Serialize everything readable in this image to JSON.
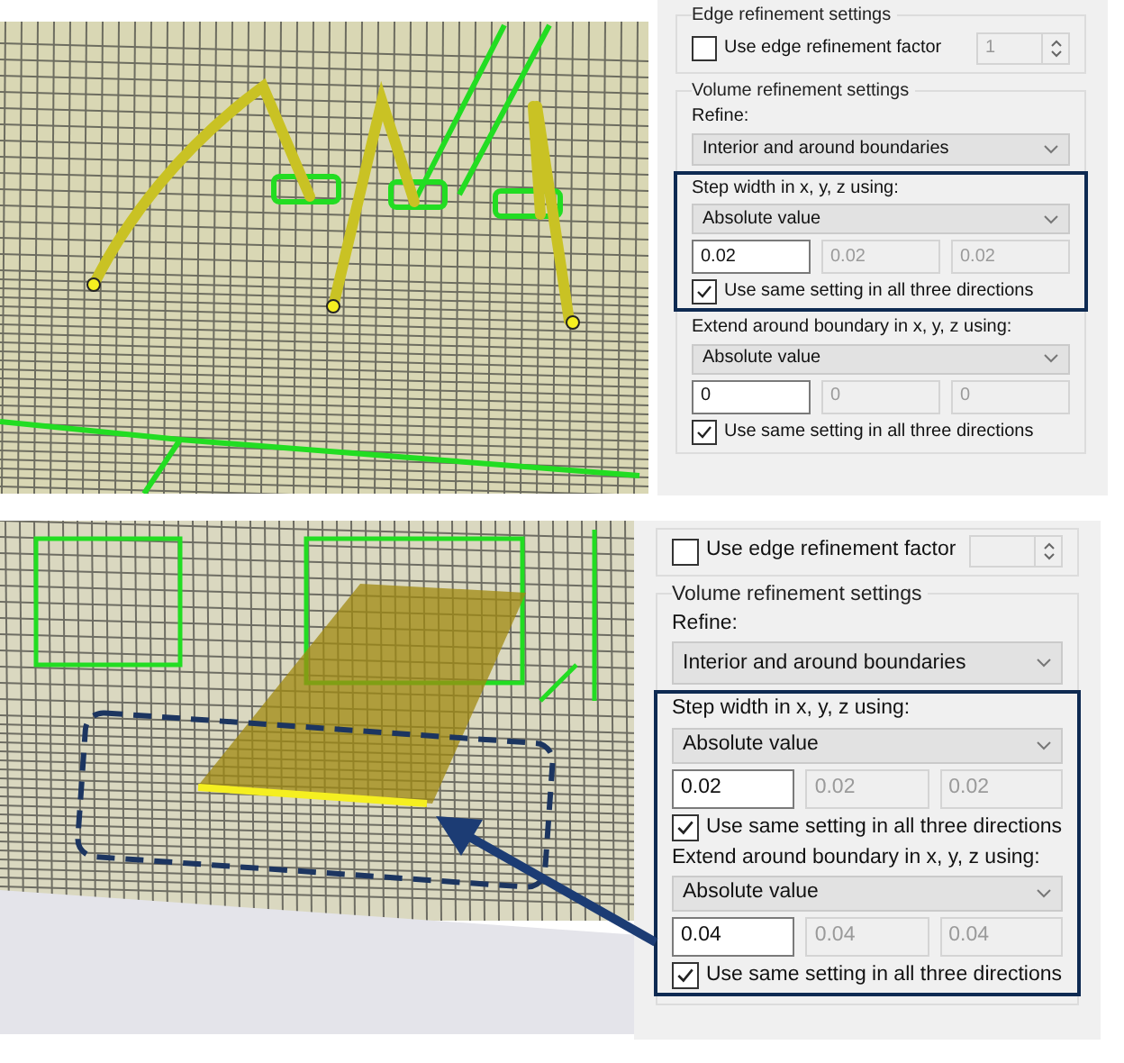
{
  "views": [
    {
      "edge_group": {
        "title": "Edge refinement settings",
        "checkbox": {
          "label": "Use edge refinement factor",
          "checked": false
        },
        "spin_value": "1"
      },
      "volume_group": {
        "title": "Volume refinement settings",
        "refine_label": "Refine:",
        "refine_value": "Interior and around boundaries",
        "sections": [
          {
            "label": "Step width in x, y, z using:",
            "mode": "Absolute value",
            "values": [
              "0.02",
              "0.02",
              "0.02"
            ],
            "same_setting": {
              "label": "Use same setting in all three directions",
              "checked": true
            },
            "highlighted": true
          },
          {
            "label": "Extend around boundary in x, y, z using:",
            "mode": "Absolute value",
            "values": [
              "0",
              "0",
              "0"
            ],
            "same_setting": {
              "label": "Use same setting in all three directions",
              "checked": true
            },
            "highlighted": false
          }
        ]
      }
    },
    {
      "edge_group": {
        "checkbox": {
          "label": "Use edge refinement factor",
          "checked": false
        }
      },
      "volume_group": {
        "title": "Volume refinement settings",
        "refine_label": "Refine:",
        "refine_value": "Interior and around boundaries",
        "sections": [
          {
            "label": "Step width in x, y, z using:",
            "mode": "Absolute value",
            "values": [
              "0.02",
              "0.02",
              "0.02"
            ],
            "same_setting": {
              "label": "Use same setting in all three directions",
              "checked": true
            },
            "highlighted": true
          },
          {
            "label": "Extend around boundary in x, y, z using:",
            "mode": "Absolute value",
            "values": [
              "0.04",
              "0.04",
              "0.04"
            ],
            "same_setting": {
              "label": "Use same setting in all three directions",
              "checked": true
            },
            "highlighted": true
          }
        ]
      }
    }
  ]
}
